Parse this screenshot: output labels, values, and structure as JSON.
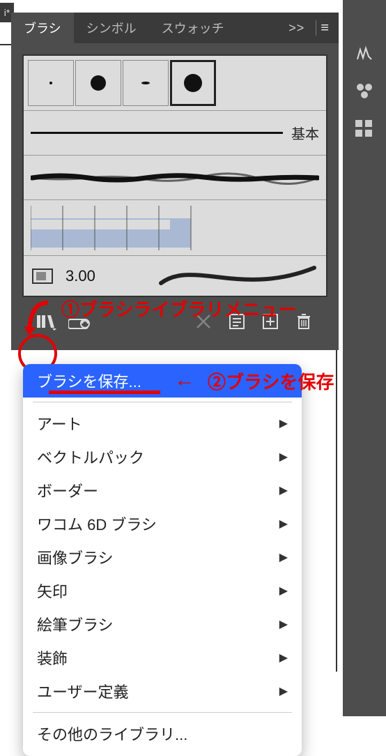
{
  "doc_tab_marker": "i*",
  "tabs": {
    "brushes": "ブラシ",
    "symbols": "シンボル",
    "swatches": "スウォッチ"
  },
  "tabs_more": ">>",
  "stroke_basic_label": "基本",
  "stroke_value": "3.00",
  "icons": {
    "library": "library-icon",
    "cloud": "cloud-library-icon",
    "scissors": "cut-icon",
    "options": "options-icon",
    "new": "new-brush-icon",
    "trash": "trash-icon",
    "menu": "menu-icon"
  },
  "annotations": {
    "a1": "①ブラシライブラリメニュー",
    "a2_arrow": "←",
    "a2_text": "②ブラシを保存"
  },
  "menu": {
    "save": "ブラシを保存...",
    "items": [
      "アート",
      "ベクトルパック",
      "ボーダー",
      "ワコム 6D ブラシ",
      "画像ブラシ",
      "矢印",
      "絵筆ブラシ",
      "装飾",
      "ユーザー定義"
    ],
    "other": "その他のライブラリ..."
  },
  "side_panel": {
    "brushes": "brushes-panel-icon",
    "symbols": "symbols-panel-icon",
    "swatches": "swatches-panel-icon"
  }
}
